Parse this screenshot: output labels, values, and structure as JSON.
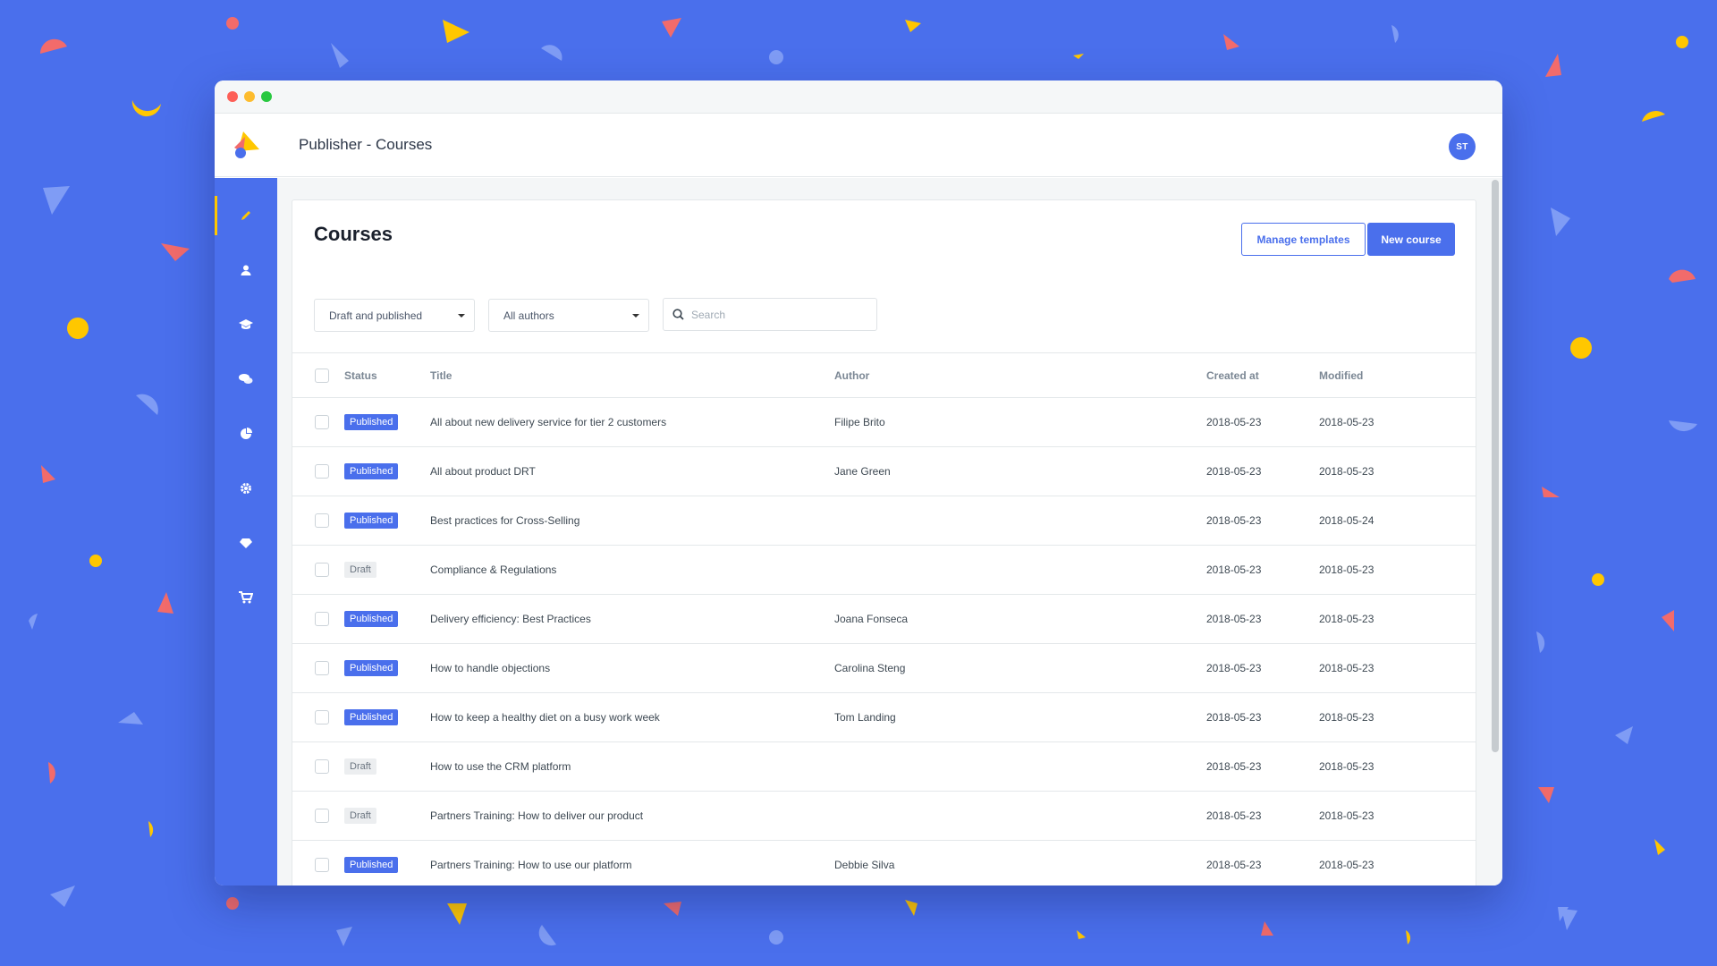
{
  "window": {
    "title": "Publisher - Courses"
  },
  "user": {
    "initials": "ST"
  },
  "sidebar": {
    "items": [
      {
        "name": "pencil-icon",
        "active": true
      },
      {
        "name": "user-icon",
        "active": false
      },
      {
        "name": "graduation-cap-icon",
        "active": false
      },
      {
        "name": "comments-icon",
        "active": false
      },
      {
        "name": "pie-chart-icon",
        "active": false
      },
      {
        "name": "gear-icon",
        "active": false
      },
      {
        "name": "diamond-icon",
        "active": false
      },
      {
        "name": "cart-icon",
        "active": false
      }
    ]
  },
  "page": {
    "title": "Courses",
    "manage_templates_label": "Manage templates",
    "new_course_label": "New course"
  },
  "filters": {
    "status_selected": "Draft and published",
    "author_selected": "All authors",
    "search_placeholder": "Search"
  },
  "table": {
    "columns": {
      "status": "Status",
      "title": "Title",
      "author": "Author",
      "created": "Created at",
      "modified": "Modified"
    },
    "rows": [
      {
        "status": "Published",
        "title": "All about new delivery service for tier 2 customers",
        "author": "Filipe Brito",
        "created": "2018-05-23",
        "modified": "2018-05-23"
      },
      {
        "status": "Published",
        "title": "All about product DRT",
        "author": "Jane Green",
        "created": "2018-05-23",
        "modified": "2018-05-23"
      },
      {
        "status": "Published",
        "title": "Best practices for Cross-Selling",
        "author": "",
        "created": "2018-05-23",
        "modified": "2018-05-24"
      },
      {
        "status": "Draft",
        "title": "Compliance & Regulations",
        "author": "",
        "created": "2018-05-23",
        "modified": "2018-05-23"
      },
      {
        "status": "Published",
        "title": "Delivery efficiency: Best Practices",
        "author": "Joana Fonseca",
        "created": "2018-05-23",
        "modified": "2018-05-23"
      },
      {
        "status": "Published",
        "title": "How to handle objections",
        "author": "Carolina Steng",
        "created": "2018-05-23",
        "modified": "2018-05-23"
      },
      {
        "status": "Published",
        "title": "How to keep a healthy diet on a busy work week",
        "author": "Tom Landing",
        "created": "2018-05-23",
        "modified": "2018-05-23"
      },
      {
        "status": "Draft",
        "title": "How to use the CRM platform",
        "author": "",
        "created": "2018-05-23",
        "modified": "2018-05-23"
      },
      {
        "status": "Draft",
        "title": "Partners Training: How to deliver our product",
        "author": "",
        "created": "2018-05-23",
        "modified": "2018-05-23"
      },
      {
        "status": "Published",
        "title": "Partners Training: How to use our platform",
        "author": "Debbie Silva",
        "created": "2018-05-23",
        "modified": "2018-05-23"
      }
    ]
  },
  "colors": {
    "accent": "#4a6fec",
    "active_indicator": "#ffc700",
    "draft_badge": "#eceef0"
  }
}
